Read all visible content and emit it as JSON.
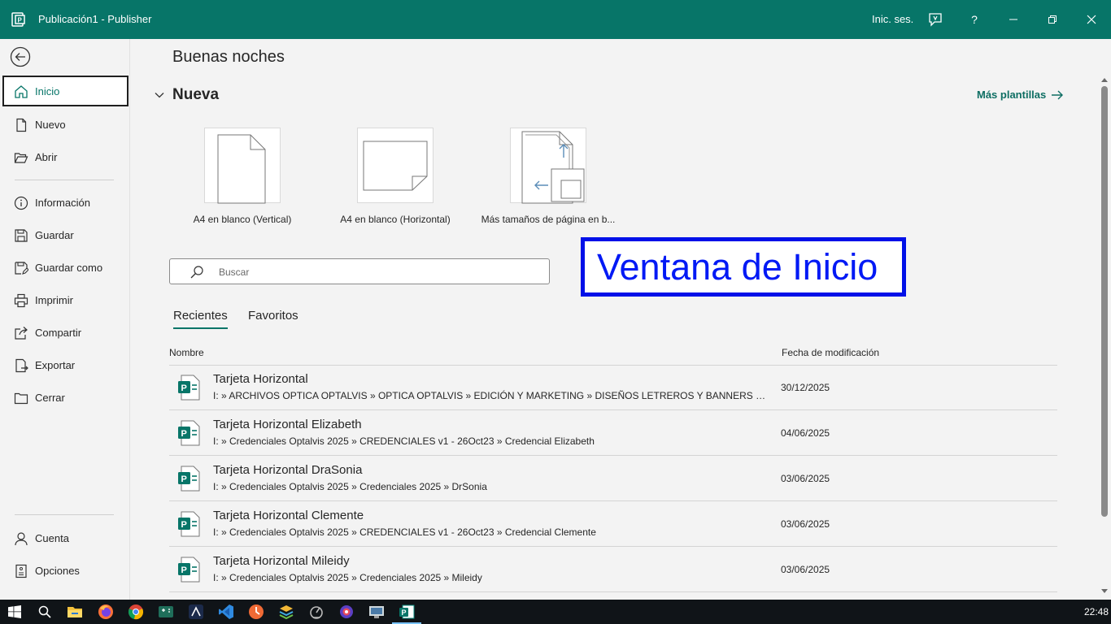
{
  "window": {
    "title": "Publicación1  -  Publisher",
    "signin_label": "Inic. ses.",
    "accent": "#077568"
  },
  "sidebar": {
    "items_top": [
      {
        "label": "Inicio",
        "icon": "home-icon",
        "active": true
      },
      {
        "label": "Nuevo",
        "icon": "new-file-icon"
      },
      {
        "label": "Abrir",
        "icon": "folder-open-icon"
      }
    ],
    "items_mid": [
      {
        "label": "Información",
        "icon": "info-icon"
      },
      {
        "label": "Guardar",
        "icon": "save-icon"
      },
      {
        "label": "Guardar como",
        "icon": "save-as-icon"
      },
      {
        "label": "Imprimir",
        "icon": "print-icon"
      },
      {
        "label": "Compartir",
        "icon": "share-icon"
      },
      {
        "label": "Exportar",
        "icon": "export-icon"
      },
      {
        "label": "Cerrar",
        "icon": "folder-close-icon"
      }
    ],
    "items_bottom": [
      {
        "label": "Cuenta",
        "icon": "account-icon"
      },
      {
        "label": "Opciones",
        "icon": "options-icon"
      }
    ]
  },
  "main": {
    "greeting": "Buenas noches",
    "new_section": "Nueva",
    "more_templates": "Más plantillas",
    "templates": [
      {
        "label": "A4 en blanco (Vertical)"
      },
      {
        "label": "A4 en blanco (Horizontal)"
      },
      {
        "label": "Más tamaños de página en b..."
      }
    ],
    "search_placeholder": "Buscar",
    "annotation": "Ventana de Inicio",
    "tabs": [
      "Recientes",
      "Favoritos"
    ],
    "columns": {
      "name": "Nombre",
      "date": "Fecha de modificación"
    },
    "files": [
      {
        "name": "Tarjeta Horizontal",
        "path": "I: » ARCHIVOS OPTICA OPTALVIS » OPTICA OPTALVIS » EDICIÓN Y MARKETING » DISEÑOS LETREROS Y BANNERS » CREDENCIA...",
        "date": "30/12/2025"
      },
      {
        "name": "Tarjeta Horizontal Elizabeth",
        "path": "I: » Credenciales Optalvis 2025 » CREDENCIALES v1 - 26Oct23 » Credencial Elizabeth",
        "date": "04/06/2025"
      },
      {
        "name": "Tarjeta Horizontal DraSonia",
        "path": "I: » Credenciales Optalvis 2025 » Credenciales 2025 » DrSonia",
        "date": "03/06/2025"
      },
      {
        "name": "Tarjeta Horizontal Clemente",
        "path": "I: » Credenciales Optalvis 2025 » CREDENCIALES v1 - 26Oct23 » Credencial Clemente",
        "date": "03/06/2025"
      },
      {
        "name": "Tarjeta Horizontal Mileidy",
        "path": "I: » Credenciales Optalvis 2025 » Credenciales 2025 » Mileidy",
        "date": "03/06/2025"
      }
    ]
  },
  "taskbar": {
    "clock": "22:48",
    "apps": [
      "windows-start-icon",
      "search-icon",
      "file-explorer-icon",
      "firefox-icon",
      "chrome-icon",
      "app-icon",
      "app-icon",
      "vscode-icon",
      "app-icon",
      "app-icon",
      "app-icon",
      "app-icon",
      "app-icon",
      "publisher-icon"
    ]
  }
}
